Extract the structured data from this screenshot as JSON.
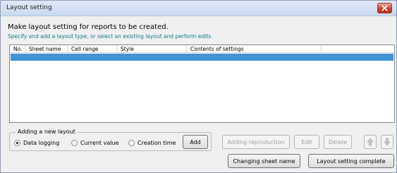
{
  "window": {
    "title": "Layout setting"
  },
  "heading": "Make layout setting for reports to be created.",
  "subheading": "Specify and add a layout type, or select an existing layout and perform edits.",
  "list": {
    "columns": [
      "No.",
      "Sheet name",
      "Cell range",
      "Style",
      "Contents of settings"
    ],
    "rows": [
      {
        "no": "",
        "sheet_name": "",
        "cell_range": "",
        "style": "",
        "contents": "",
        "selected": true
      }
    ]
  },
  "new_layout": {
    "group_label": "Adding a new layout",
    "options": [
      {
        "label": "Data logging",
        "selected": true
      },
      {
        "label": "Current value",
        "selected": false
      },
      {
        "label": "Creation time",
        "selected": false
      }
    ],
    "add_label": "Add"
  },
  "actions": {
    "adding_reproduction": "Adding reproduction",
    "edit": "Edit",
    "delete": "Delete",
    "changing_sheet_name": "Changing sheet name",
    "layout_setting_complete": "Layout setting complete"
  },
  "icons": {
    "close": "close-icon",
    "move_up": "arrow-up-icon",
    "move_down": "arrow-down-icon"
  },
  "colors": {
    "selection": "#3a8fd4",
    "subheading": "#0f7c8a",
    "close_button": "#c9432f"
  }
}
